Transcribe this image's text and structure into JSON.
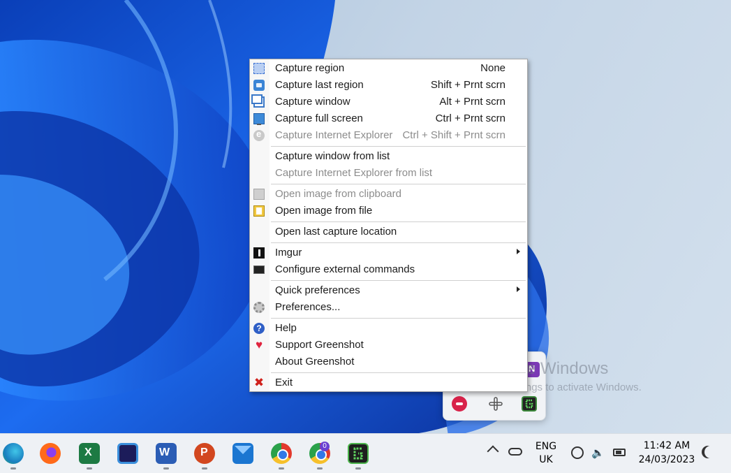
{
  "watermark": {
    "line1": "Activate Windows",
    "line2": "Go to Settings to activate Windows."
  },
  "menu": {
    "items": [
      {
        "label": "Capture region",
        "shortcut": "None",
        "icon": "capture-region-icon",
        "disabled": false
      },
      {
        "label": "Capture last region",
        "shortcut": "Shift + Prnt scrn",
        "icon": "capture-last-region-icon",
        "disabled": false
      },
      {
        "label": "Capture window",
        "shortcut": "Alt + Prnt scrn",
        "icon": "capture-window-icon",
        "disabled": false
      },
      {
        "label": "Capture full screen",
        "shortcut": "Ctrl + Prnt scrn",
        "icon": "monitor-icon",
        "disabled": false
      },
      {
        "label": "Capture Internet Explorer",
        "shortcut": "Ctrl + Shift + Prnt scrn",
        "icon": "internet-explorer-icon",
        "disabled": true
      },
      {
        "label": "Capture window from list",
        "shortcut": "",
        "icon": "",
        "disabled": false
      },
      {
        "label": "Capture Internet Explorer from list",
        "shortcut": "",
        "icon": "",
        "disabled": true
      },
      {
        "label": "Open image from clipboard",
        "shortcut": "",
        "icon": "clipboard-icon",
        "disabled": true
      },
      {
        "label": "Open image from file",
        "shortcut": "",
        "icon": "open-file-icon",
        "disabled": false
      },
      {
        "label": "Open last capture location",
        "shortcut": "",
        "icon": "",
        "disabled": false
      },
      {
        "label": "Imgur",
        "shortcut": "",
        "icon": "imgur-icon",
        "disabled": false,
        "submenu": true
      },
      {
        "label": "Configure external commands",
        "shortcut": "",
        "icon": "terminal-icon",
        "disabled": false
      },
      {
        "label": "Quick preferences",
        "shortcut": "",
        "icon": "",
        "disabled": false,
        "submenu": true
      },
      {
        "label": "Preferences...",
        "shortcut": "",
        "icon": "gear-icon",
        "disabled": false
      },
      {
        "label": "Help",
        "shortcut": "",
        "icon": "help-icon",
        "disabled": false
      },
      {
        "label": "Support Greenshot",
        "shortcut": "",
        "icon": "heart-icon",
        "disabled": false
      },
      {
        "label": "About Greenshot",
        "shortcut": "",
        "icon": "",
        "disabled": false
      },
      {
        "label": "Exit",
        "shortcut": "",
        "icon": "close-icon",
        "disabled": false
      }
    ]
  },
  "taskbar": {
    "apps": [
      "Edge",
      "Firefox",
      "Excel",
      "Slack",
      "Word",
      "PowerPoint",
      "Mail",
      "Chrome",
      "Chrome",
      "Greenshot"
    ],
    "chrome_badge": "0",
    "language_line1": "ENG",
    "language_line2": "UK",
    "time": "11:42 AM",
    "date": "24/03/2023"
  },
  "colors": {
    "wallpaper_blue": "#1e5fe0",
    "menu_bg": "#ffffff",
    "disabled_text": "#8c8c8c",
    "taskbar_bg": "#eef1f5"
  }
}
